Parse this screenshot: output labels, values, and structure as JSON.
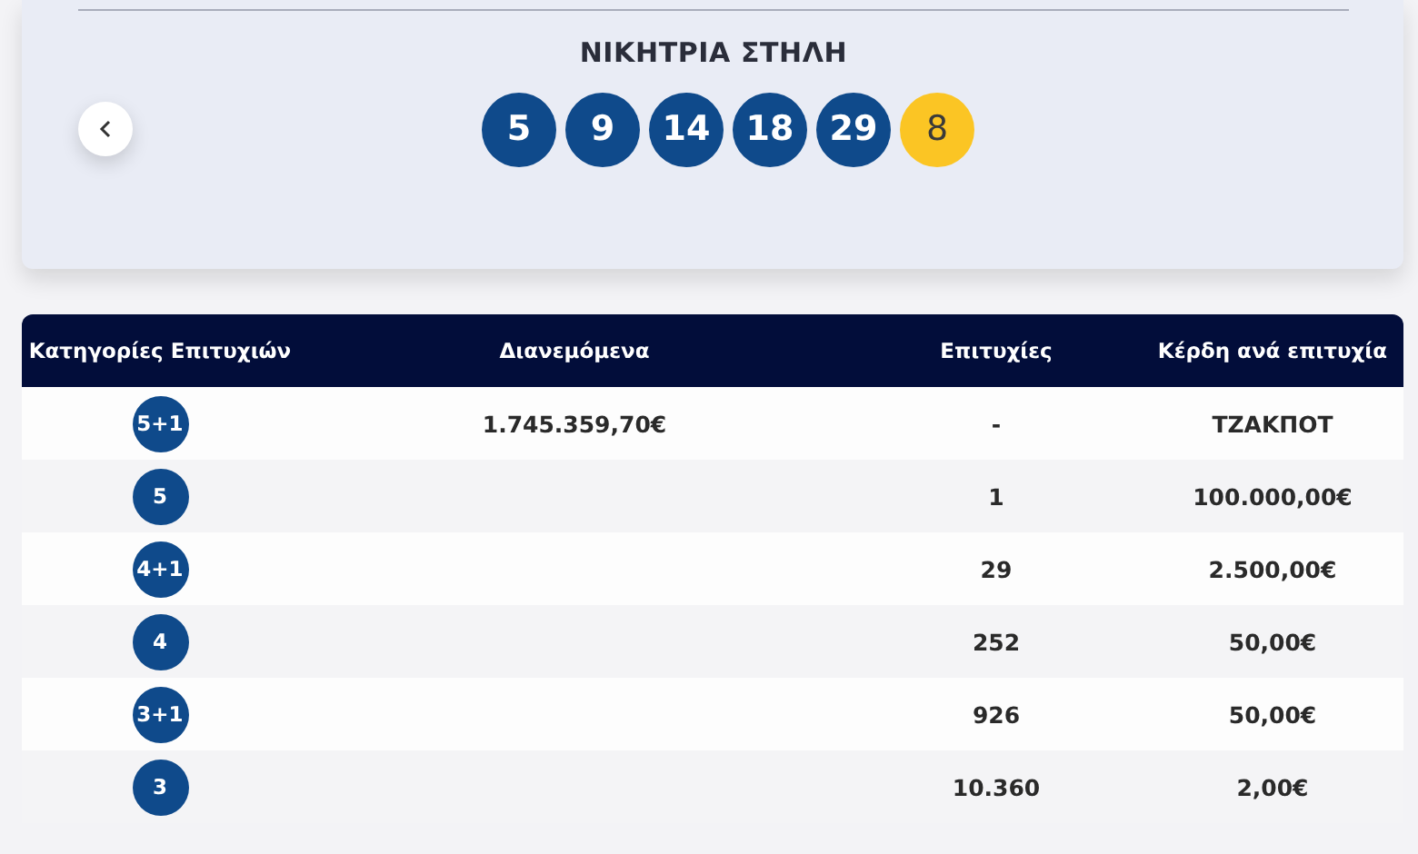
{
  "winning_column": {
    "title": "ΝΙΚΗΤΡΙΑ ΣΤΗΛΗ",
    "balls": [
      {
        "number": "5",
        "kind": "main"
      },
      {
        "number": "9",
        "kind": "main"
      },
      {
        "number": "14",
        "kind": "main"
      },
      {
        "number": "18",
        "kind": "main"
      },
      {
        "number": "29",
        "kind": "main"
      },
      {
        "number": "8",
        "kind": "bonus"
      }
    ]
  },
  "table": {
    "columns": [
      "Κατηγορίες Επιτυχιών",
      "Διανεμόμενα",
      "Επιτυχίες",
      "Κέρδη ανά επιτυχία"
    ],
    "rows": [
      {
        "category": "5+1",
        "distributed": "1.745.359,70€",
        "winners": "-",
        "prize": "ΤΖΑΚΠΟΤ"
      },
      {
        "category": "5",
        "winners": "1",
        "prize": "100.000,00€"
      },
      {
        "category": "4+1",
        "winners": "29",
        "prize": "2.500,00€"
      },
      {
        "category": "4",
        "winners": "252",
        "prize": "50,00€"
      },
      {
        "category": "3+1",
        "winners": "926",
        "prize": "50,00€"
      },
      {
        "category": "3",
        "winners": "10.360",
        "prize": "2,00€"
      }
    ]
  }
}
